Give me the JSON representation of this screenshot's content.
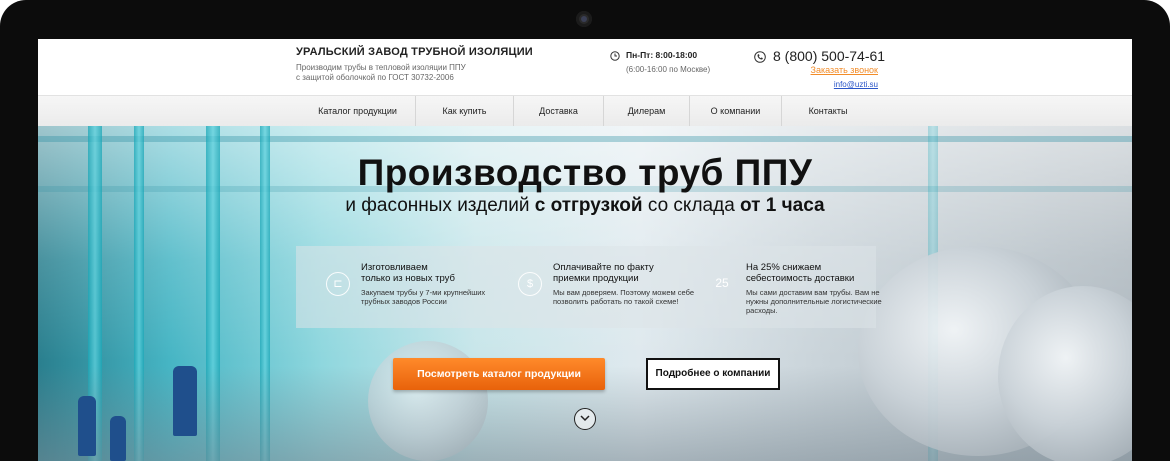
{
  "header": {
    "brand_title": "УРАЛЬСКИЙ ЗАВОД ТРУБНОЙ ИЗОЛЯЦИИ",
    "brand_subtitle_line1": "Производим трубы в тепловой изоляции ППУ",
    "brand_subtitle_line2": "с защитой оболочкой по ГОСТ 30732-2006",
    "hours_main": "Пн-Пт: 8:00-18:00",
    "hours_note": "(6:00-16:00 по Москве)",
    "phone": "8 (800) 500-74-61",
    "callback_label": "Заказать звонок",
    "email": "info@uzti.su"
  },
  "nav": {
    "items": [
      {
        "label": "Каталог продукции"
      },
      {
        "label": "Как купить"
      },
      {
        "label": "Доставка"
      },
      {
        "label": "Дилерам"
      },
      {
        "label": "О компании"
      },
      {
        "label": "Контакты"
      }
    ]
  },
  "hero": {
    "title": "Производство труб ППУ",
    "subtitle_part1": "и фасонных изделий ",
    "subtitle_bold1": "с отгрузкой",
    "subtitle_part2": " со склада ",
    "subtitle_bold2": "от 1 часа",
    "features": [
      {
        "icon": "pipe-icon",
        "title_line1": "Изготовливаем",
        "title_line2": "только из новых труб",
        "text": "Закупаем трубы у 7-ми крупнейших трубных заводов России"
      },
      {
        "icon": "money-icon",
        "title_line1": "Оплачивайте по факту",
        "title_line2": "приемки продукции",
        "text": "Мы вам доверяем. Поэтому можем себе позволить работать по такой схеме!"
      },
      {
        "icon": "percent-icon",
        "icon_text": "25",
        "title_line1": "На 25% снижаем",
        "title_line2": "себестоимость доставки",
        "text": "Мы сами доставим вам трубы. Вам не нужны дополнительные логистические расходы."
      }
    ],
    "primary_button": "Посмотреть каталог продукции",
    "secondary_button": "Подробнее о компании"
  },
  "colors": {
    "accent_orange": "#e8620b",
    "link_blue": "#2a55c8",
    "frame_black": "#0c0c0c"
  }
}
